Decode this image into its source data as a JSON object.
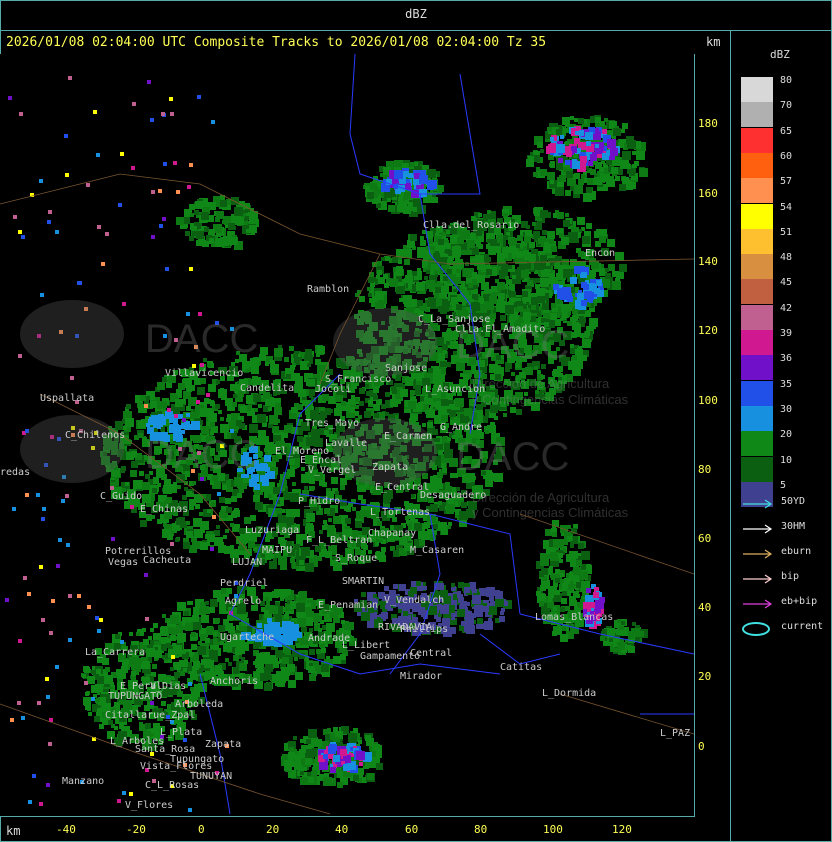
{
  "header": {
    "title": "dBZ",
    "subtitle": "2026/01/08 02:04:00 UTC Composite Tracks to 2026/01/08 02:04:00 Tz 35",
    "km_top": "km",
    "km_bottom": "km"
  },
  "axes": {
    "y_ticks": [
      "180",
      "160",
      "140",
      "120",
      "100",
      "80",
      "60",
      "40",
      "20",
      "0"
    ],
    "x_ticks": [
      "-40",
      "-20",
      "0",
      "20",
      "40",
      "60",
      "80",
      "100",
      "120"
    ]
  },
  "legend": {
    "title": "dBZ",
    "levels": [
      {
        "label": "80",
        "color": "#d8d8d8"
      },
      {
        "label": "70",
        "color": "#b0b0b0"
      },
      {
        "label": "65",
        "color": "#ff3030"
      },
      {
        "label": "60",
        "color": "#ff6010"
      },
      {
        "label": "57",
        "color": "#ff9050"
      },
      {
        "label": "54",
        "color": "#ffff00"
      },
      {
        "label": "51",
        "color": "#ffc030"
      },
      {
        "label": "48",
        "color": "#d89040"
      },
      {
        "label": "45",
        "color": "#c06040"
      },
      {
        "label": "42",
        "color": "#c06090"
      },
      {
        "label": "39",
        "color": "#d01890"
      },
      {
        "label": "36",
        "color": "#7010c8"
      },
      {
        "label": "35",
        "color": "#2050e8"
      },
      {
        "label": "30",
        "color": "#1890e0"
      },
      {
        "label": "20",
        "color": "#108818"
      },
      {
        "label": "10",
        "color": "#0a6010"
      },
      {
        "label": "5",
        "color": "#404090"
      }
    ],
    "tracks": [
      {
        "label": "50YD",
        "color": "#40e0e0",
        "icon": "arrow-icon"
      },
      {
        "label": "30HM",
        "color": "#ffffff",
        "icon": "arrow-icon"
      },
      {
        "label": "eburn",
        "color": "#e0b060",
        "icon": "arrow-icon"
      },
      {
        "label": "bip",
        "color": "#ffd0d0",
        "icon": "arrow-icon"
      },
      {
        "label": "eb+bip",
        "color": "#e040e0",
        "icon": "arrow-icon"
      },
      {
        "label": "current",
        "color": "#40e0e0",
        "icon": "ellipse-icon"
      }
    ]
  },
  "places": [
    {
      "name": "Clla.del_Rosario"
    },
    {
      "name": "Encon"
    },
    {
      "name": "Ramblon"
    },
    {
      "name": "C_La_Sanjose"
    },
    {
      "name": "Clla.El_Amadito"
    },
    {
      "name": "Sanjose"
    },
    {
      "name": "L_Asuncion"
    },
    {
      "name": "Uspallata"
    },
    {
      "name": "Villavicencio"
    },
    {
      "name": "Candelita"
    },
    {
      "name": "S_Francisco"
    },
    {
      "name": "Jocoli"
    },
    {
      "name": "C_Chilenos"
    },
    {
      "name": "Tres_Mayo"
    },
    {
      "name": "Lavalle"
    },
    {
      "name": "E_Carmen"
    },
    {
      "name": "G_Andre"
    },
    {
      "name": "El_Moreno"
    },
    {
      "name": "E_Encal"
    },
    {
      "name": "V_Vergel"
    },
    {
      "name": "Zapata"
    },
    {
      "name": "P_Hidro"
    },
    {
      "name": "E_Central"
    },
    {
      "name": "Desaguadero"
    },
    {
      "name": "C_Guido"
    },
    {
      "name": "E_Chinas"
    },
    {
      "name": "L_Tortenas"
    },
    {
      "name": "Cacheuta"
    },
    {
      "name": "Potrerillos"
    },
    {
      "name": "Vegas"
    },
    {
      "name": "Luzuriaga"
    },
    {
      "name": "MAIPU"
    },
    {
      "name": "LUJAN"
    },
    {
      "name": "F_L_Beltran"
    },
    {
      "name": "Chapanay"
    },
    {
      "name": "Perdriel"
    },
    {
      "name": "S_Roque"
    },
    {
      "name": "M_Casaren"
    },
    {
      "name": "SMARTIN"
    },
    {
      "name": "V_Vendalch"
    },
    {
      "name": "Agrelo"
    },
    {
      "name": "E_Penamian"
    },
    {
      "name": "RIVADAVIA"
    },
    {
      "name": "Phillips"
    },
    {
      "name": "Andrade"
    },
    {
      "name": "Ugarteche"
    },
    {
      "name": "L_Libert"
    },
    {
      "name": "Gampamento"
    },
    {
      "name": "Central"
    },
    {
      "name": "Mirador"
    },
    {
      "name": "Lomas_Blancas"
    },
    {
      "name": "La_Carrera"
    },
    {
      "name": "Catitas"
    },
    {
      "name": "Anchoris"
    },
    {
      "name": "E_Peral"
    },
    {
      "name": "V_Dias"
    },
    {
      "name": "TUPUNGATO"
    },
    {
      "name": "L_Dormida"
    },
    {
      "name": "Arboleda"
    },
    {
      "name": "Citallarue_Zpal"
    },
    {
      "name": "L_Arboles"
    },
    {
      "name": "L_Plata"
    },
    {
      "name": "Zapata"
    },
    {
      "name": "Vista_Flores"
    },
    {
      "name": "L_PAZ"
    },
    {
      "name": "Manzano"
    },
    {
      "name": "C_L_Rosas"
    },
    {
      "name": "TUNUYAN"
    },
    {
      "name": "V_Flores"
    },
    {
      "name": "redas"
    },
    {
      "name": "Santa_Rosa"
    },
    {
      "name": "Tupungato"
    }
  ],
  "watermark": {
    "brand": "DACC",
    "line1": "Dirección de Agricultura",
    "line2": "y Contingencias Climáticas"
  }
}
